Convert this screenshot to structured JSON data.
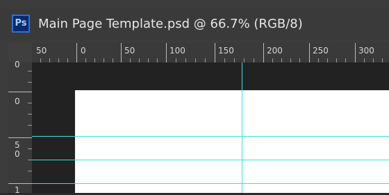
{
  "app": {
    "icon_label": "Ps"
  },
  "document": {
    "title": "Main Page Template.psd @ 66.7% (RGB/8)"
  },
  "ruler_horizontal": {
    "labels": [
      "50",
      "0",
      "50",
      "100",
      "150",
      "200",
      "250",
      "300"
    ]
  },
  "ruler_vertical": {
    "labels": [
      "0",
      "0",
      "5",
      "0",
      "1"
    ]
  },
  "colors": {
    "guide": "#33e3e3",
    "canvas": "#ffffff",
    "pasteboard": "#222222",
    "ps_badge": "#0a2a6a"
  }
}
